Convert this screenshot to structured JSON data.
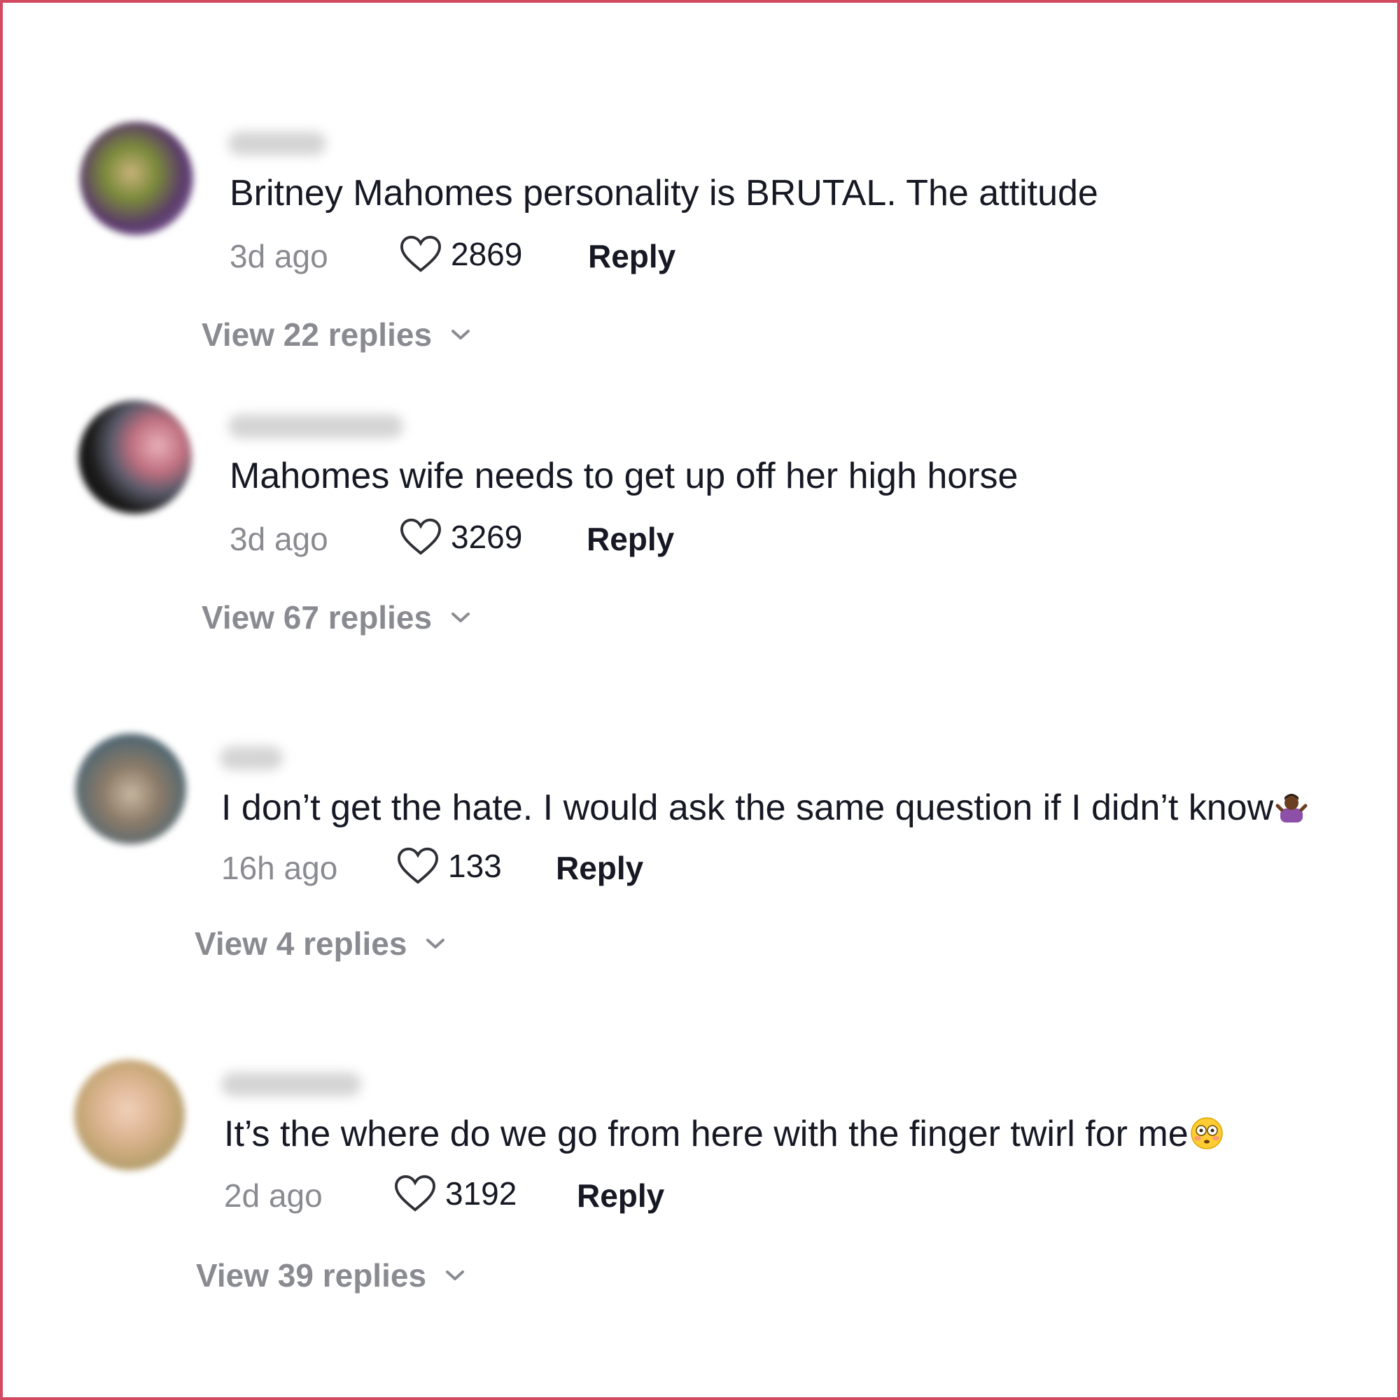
{
  "comments": [
    {
      "text": "Britney Mahomes personality is BRUTAL. The attitude",
      "time": "3d ago",
      "likes": "2869",
      "reply_label": "Reply",
      "view_replies": "View 22 replies"
    },
    {
      "text": "Mahomes wife needs to get up off her high horse",
      "time": "3d ago",
      "likes": "3269",
      "reply_label": "Reply",
      "view_replies": "View 67 replies"
    },
    {
      "text": "I don’t get the hate. I would ask the same question if I didn’t know",
      "emoji": "shrugging-person-emoji",
      "time": "16h ago",
      "likes": "133",
      "reply_label": "Reply",
      "view_replies": "View 4 replies"
    },
    {
      "text": "It’s the where do we go from here with the finger twirl for me",
      "emoji": "flushed-face-emoji",
      "time": "2d ago",
      "likes": "3192",
      "reply_label": "Reply",
      "view_replies": "View 39 replies"
    }
  ],
  "colors": {
    "border": "#d24a62",
    "text_primary": "#161823",
    "text_secondary": "#8a8b91"
  },
  "icons": {
    "like": "heart-outline-icon",
    "expand": "chevron-down-icon"
  }
}
